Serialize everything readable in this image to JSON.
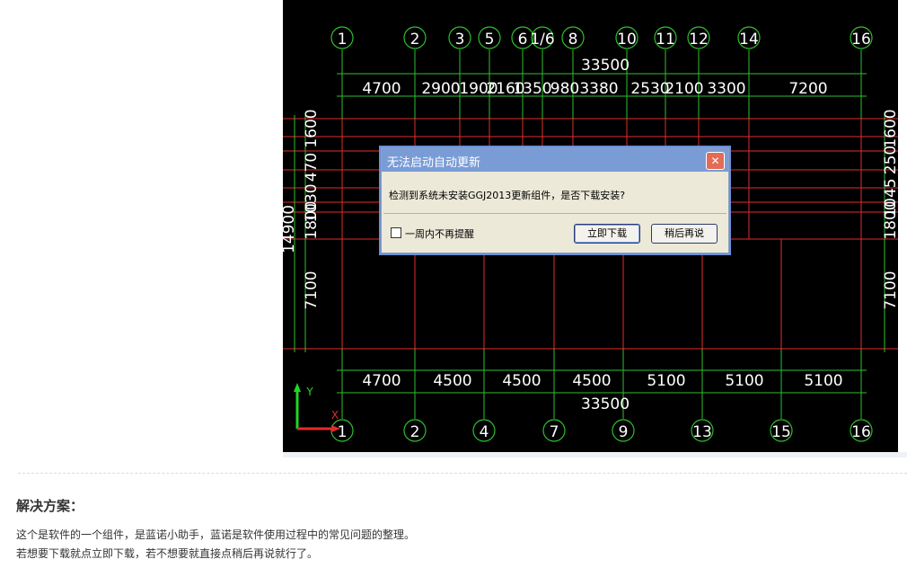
{
  "cad": {
    "top_axis_labels": [
      "1",
      "2",
      "3",
      "5",
      "6",
      "1/6",
      "8",
      "10",
      "11",
      "12",
      "14",
      "16"
    ],
    "bottom_axis_labels": [
      "1",
      "2",
      "4",
      "7",
      "9",
      "13",
      "15",
      "16"
    ],
    "top_total": "33500",
    "top_spans": [
      "4700",
      "2900",
      "1900",
      "2160",
      "1350",
      "980",
      "3380",
      "2530",
      "2100",
      "3300",
      "7200"
    ],
    "bottom_total": "33500",
    "bottom_spans": [
      "4700",
      "4500",
      "4500",
      "4500",
      "5100",
      "5100",
      "5100"
    ],
    "left_dims": [
      "14900",
      "1800",
      "1030",
      "470",
      "1600",
      "7100"
    ],
    "right_dims": [
      "1800",
      "1045",
      "250",
      "1600",
      "7100"
    ],
    "ucs_y": "Y",
    "ucs_x": "X",
    "colors": {
      "grid_red": "#e32b2b",
      "dim_green": "#2fbf2f",
      "axis_circle": "#2fbf2f"
    }
  },
  "dialog": {
    "title": "无法启动自动更新",
    "message": "检测到系统未安装GGJ2013更新组件，是否下载安装?",
    "checkbox_label": "一周内不再提醒",
    "primary_button": "立即下载",
    "secondary_button": "稍后再说",
    "close_glyph": "✕"
  },
  "solution": {
    "title": "解决方案：",
    "line1": "这个是软件的一个组件，是蓝诺小助手，蓝诺是软件使用过程中的常见问题的整理。",
    "line2": "若想要下载就点立即下载，若不想要就直接点稍后再说就行了。"
  }
}
